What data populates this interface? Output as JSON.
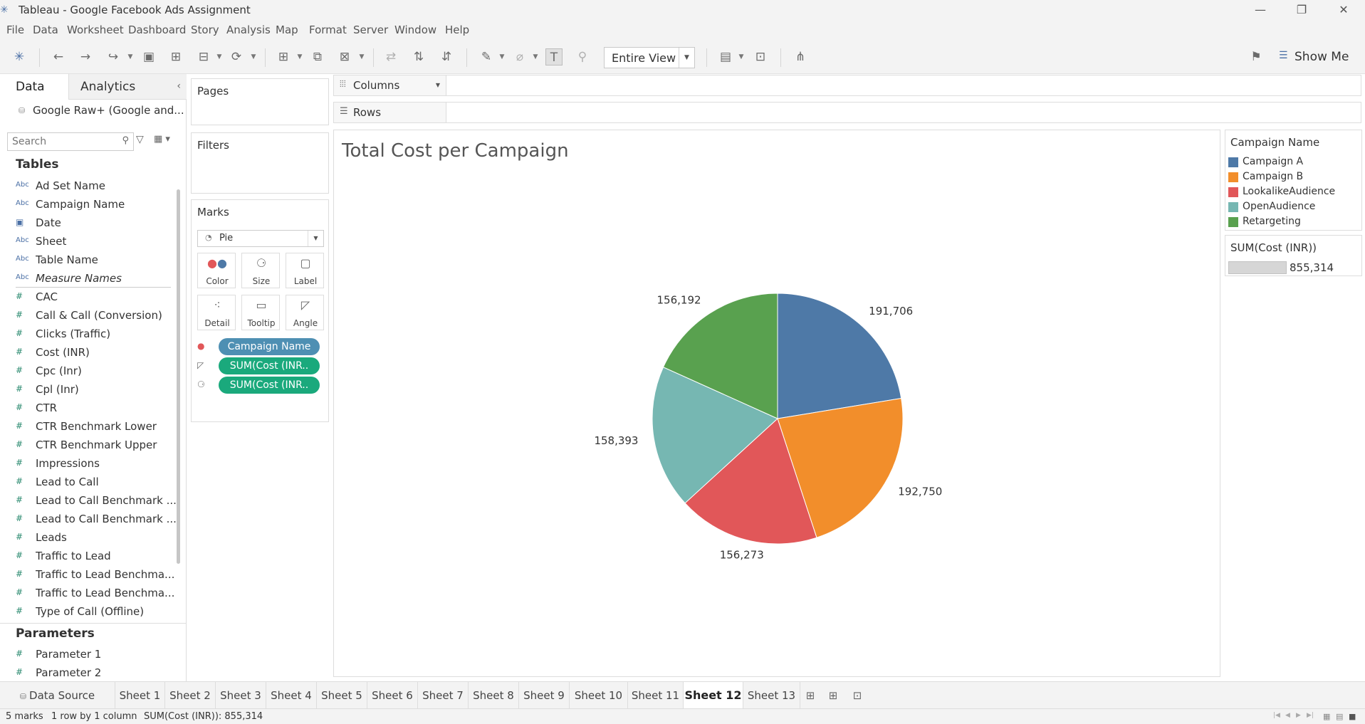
{
  "window": {
    "title": "Tableau - Google Facebook Ads Assignment",
    "app_icon": "tableau-logo-icon"
  },
  "menu": [
    "File",
    "Data",
    "Worksheet",
    "Dashboard",
    "Story",
    "Analysis",
    "Map",
    "Format",
    "Server",
    "Window",
    "Help"
  ],
  "toolbar": {
    "fit_label": "Entire View",
    "show_me_label": "Show Me"
  },
  "data_pane": {
    "tab_data": "Data",
    "tab_analytics": "Analytics",
    "datasource": "Google Raw+ (Google and...",
    "search_placeholder": "Search",
    "tables_heading": "Tables",
    "dimensions": [
      {
        "type": "abc",
        "label": "Ad Set Name"
      },
      {
        "type": "abc",
        "label": "Campaign Name"
      },
      {
        "type": "date",
        "label": "Date"
      },
      {
        "type": "abc",
        "label": "Sheet"
      },
      {
        "type": "abc",
        "label": "Table Name"
      },
      {
        "type": "abc",
        "label": "Measure Names"
      }
    ],
    "measures": [
      "CAC",
      "Call & Call (Conversion)",
      "Clicks (Traffic)",
      "Cost (INR)",
      "Cpc (Inr)",
      "Cpl (Inr)",
      "CTR",
      "CTR Benchmark Lower",
      "CTR Benchmark Upper",
      "Impressions",
      "Lead to Call",
      "Lead to Call Benchmark ...",
      "Lead to Call Benchmark ...",
      "Leads",
      "Traffic to Lead",
      "Traffic to Lead Benchma...",
      "Traffic to Lead Benchma...",
      "Type of Call (Offline)"
    ],
    "parameters_heading": "Parameters",
    "parameters": [
      "Parameter 1",
      "Parameter 2"
    ]
  },
  "cards": {
    "pages": "Pages",
    "filters": "Filters",
    "marks": "Marks",
    "mark_type": "Pie",
    "mark_buttons": [
      {
        "label": "Color",
        "icon": "color-dots-icon"
      },
      {
        "label": "Size",
        "icon": "size-icon"
      },
      {
        "label": "Label",
        "icon": "label-icon"
      },
      {
        "label": "Detail",
        "icon": "detail-icon"
      },
      {
        "label": "Tooltip",
        "icon": "tooltip-icon"
      },
      {
        "label": "Angle",
        "icon": "angle-icon"
      }
    ],
    "pills": [
      {
        "icon": "color-dots-icon",
        "label": "Campaign Name",
        "color": "#4e8fb3"
      },
      {
        "icon": "angle-icon",
        "label": "SUM(Cost (INR..",
        "color": "#1aa97c"
      },
      {
        "icon": "size-icon",
        "label": "SUM(Cost (INR..",
        "color": "#1aa97c"
      }
    ]
  },
  "shelves": {
    "columns": "Columns",
    "rows": "Rows"
  },
  "view": {
    "title": "Total Cost per Campaign"
  },
  "chart_data": {
    "type": "pie",
    "title": "Total Cost per Campaign",
    "categories": [
      "Campaign A",
      "Campaign B",
      "LookalikeAudience",
      "OpenAudience",
      "Retargeting"
    ],
    "values": [
      191706,
      192750,
      156273,
      158393,
      156192
    ],
    "labels": [
      "191,706",
      "192,750",
      "156,273",
      "158,393",
      "156,192"
    ],
    "colors": [
      "#4e79a7",
      "#f28e2b",
      "#e15759",
      "#76b7b2",
      "#59a14f"
    ],
    "legend": "right"
  },
  "legend": {
    "title": "Campaign Name",
    "items": [
      {
        "label": "Campaign A",
        "color": "#4e79a7"
      },
      {
        "label": "Campaign B",
        "color": "#f28e2b"
      },
      {
        "label": "LookalikeAudience",
        "color": "#e15759"
      },
      {
        "label": "OpenAudience",
        "color": "#76b7b2"
      },
      {
        "label": "Retargeting",
        "color": "#59a14f"
      }
    ]
  },
  "size_legend": {
    "title": "SUM(Cost (INR))",
    "value": "855,314"
  },
  "sheet_tabs": {
    "data_source": "Data Source",
    "sheets": [
      "Sheet 1",
      "Sheet 2",
      "Sheet 3",
      "Sheet 4",
      "Sheet 5",
      "Sheet 6",
      "Sheet 7",
      "Sheet 8",
      "Sheet 9",
      "Sheet 10",
      "Sheet 11",
      "Sheet 12",
      "Sheet 13"
    ],
    "active": "Sheet 12"
  },
  "status": {
    "marks": "5 marks",
    "dims": "1 row by 1 column",
    "sum": "SUM(Cost (INR)): 855,314"
  }
}
